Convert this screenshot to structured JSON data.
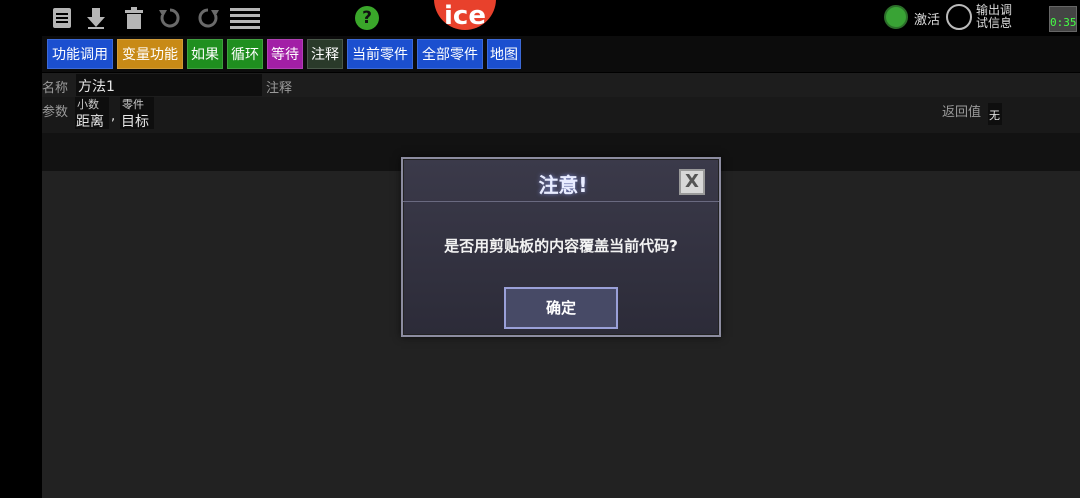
{
  "toolbar": {
    "icons": [
      "list-icon",
      "download-icon",
      "trash-icon",
      "undo-icon",
      "redo-icon",
      "stack-icon"
    ],
    "logo_text": "ice",
    "help_label": "?",
    "activate_label": "激活",
    "debug_label": "输出调试信息",
    "timer": "0:35"
  },
  "tabs": [
    {
      "label": "功能调用",
      "color": "#1b4fcf"
    },
    {
      "label": "变量功能",
      "color": "#c88a16"
    },
    {
      "label": "如果",
      "color": "#1f8f1f"
    },
    {
      "label": "循环",
      "color": "#1f8f1f"
    },
    {
      "label": "等待",
      "color": "#a21fa6"
    },
    {
      "label": "注释",
      "color": "#2a3a2a"
    },
    {
      "label": "当前零件",
      "color": "#1b4fcf"
    },
    {
      "label": "全部零件",
      "color": "#1b4fcf"
    },
    {
      "label": "地图",
      "color": "#1b4fcf"
    }
  ],
  "method": {
    "name_label": "名称",
    "name_value": "方法1",
    "comment_label": "注释",
    "params_label": "参数",
    "params": [
      {
        "type": "小数",
        "name": "距离"
      },
      {
        "type": "零件",
        "name": "目标"
      }
    ],
    "param_separator": ",",
    "return_label": "返回值",
    "return_value": "无"
  },
  "dialog": {
    "title": "注意!",
    "close_label": "X",
    "message": "是否用剪贴板的内容覆盖当前代码?",
    "ok_label": "确定"
  }
}
